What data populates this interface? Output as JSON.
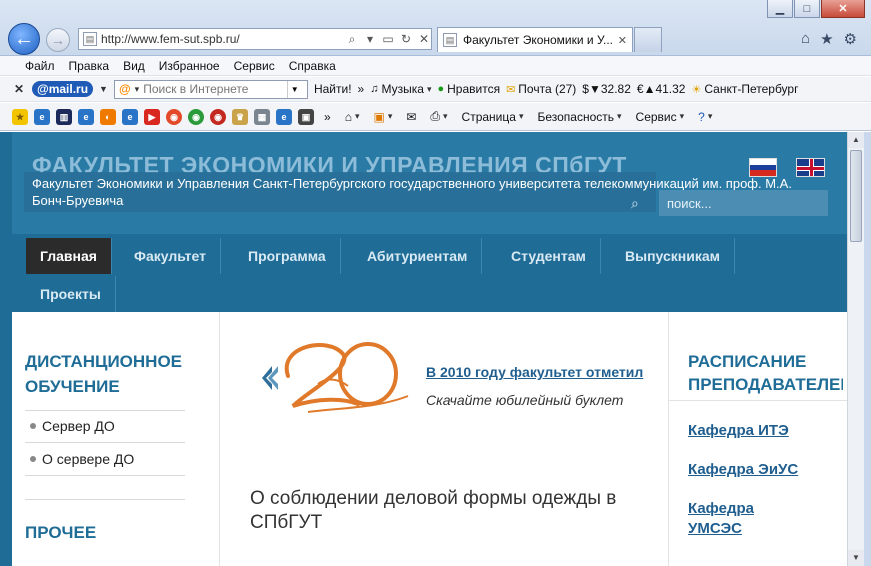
{
  "browser": {
    "url": "http://www.fem-sut.spb.ru/",
    "tab_title": "Факультет Экономики и У...",
    "menu": [
      "Файл",
      "Правка",
      "Вид",
      "Избранное",
      "Сервис",
      "Справка"
    ],
    "mailru_logo": "@mail.ru",
    "search_placeholder": "Поиск в Интернете",
    "search_button": "Найти!",
    "music": "Музыка",
    "likes": "Нравится",
    "mail": "Почта (27)",
    "usd": "$▼32.82",
    "eur": "€▲41.32",
    "city": "Санкт-Петербург",
    "page_menu": "Страница",
    "security_menu": "Безопасность",
    "tools_menu": "Сервис"
  },
  "site": {
    "title": "ФАКУЛЬТЕТ ЭКОНОМИКИ И УПРАВЛЕНИЯ СПбГУТ",
    "subtitle": "Факультет Экономики и Управления Санкт-Петербургского государственного университета телекоммуникаций им. проф. М.А. Бонч-Бруевича",
    "search_placeholder": "поиск...",
    "nav": [
      "Главная",
      "Факультет",
      "Программа",
      "Абитуриентам",
      "Студентам",
      "Выпускникам",
      "Проекты"
    ]
  },
  "left": {
    "title1_line1": "ДИСТАНЦИОННОЕ",
    "title1_line2": "ОБУЧЕНИЕ",
    "items": [
      "Сервер ДО",
      "О сервере ДО"
    ],
    "title2": "ПРОЧЕЕ"
  },
  "middle": {
    "news_link": "В 2010 году факультет отметил",
    "news_sub": "Скачайте юбилейный буклет",
    "article_title": "О соблюдении деловой формы одежды в СПбГУТ"
  },
  "right": {
    "title_line1": "РАСПИСАНИЕ",
    "title_line2": "ПРЕПОДАВАТЕЛЕЙ",
    "links": [
      "Кафедра ИТЭ",
      "Кафедра ЭиУС",
      "Кафедра УМСЭС"
    ]
  },
  "colors": {
    "header": "#2a7aa6",
    "nav": "#1f6d97",
    "active_nav": "#2b2b2b",
    "link": "#1f5e8f"
  }
}
